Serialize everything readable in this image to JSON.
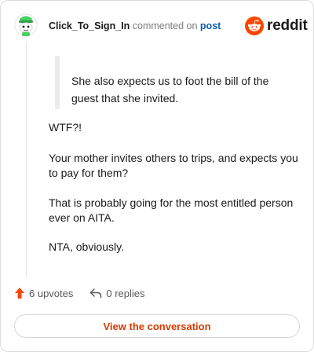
{
  "comment": {
    "username": "Click_To_Sign_In",
    "action_text": "commented on",
    "post_link_label": "post"
  },
  "brand": {
    "logo_text": "reddit",
    "accent_color": "#ff4500"
  },
  "body": {
    "quote": "She also expects us to foot the bill of the guest that she invited.",
    "paragraphs": [
      "WTF?!",
      "Your mother invites others to trips, and expects you to pay for them?",
      "That is probably going for the most entitled person ever on AITA.",
      "NTA, obviously."
    ]
  },
  "footer": {
    "upvotes_label": "6 upvotes",
    "replies_label": "0 replies",
    "upvote_icon": "upvote-arrow-icon",
    "reply_icon": "reply-arrow-icon"
  },
  "cta": {
    "label": "View the conversation",
    "color": "#d93a00"
  },
  "avatar": {
    "icon": "snoo-avatar-icon",
    "accent_color": "#46d160"
  }
}
